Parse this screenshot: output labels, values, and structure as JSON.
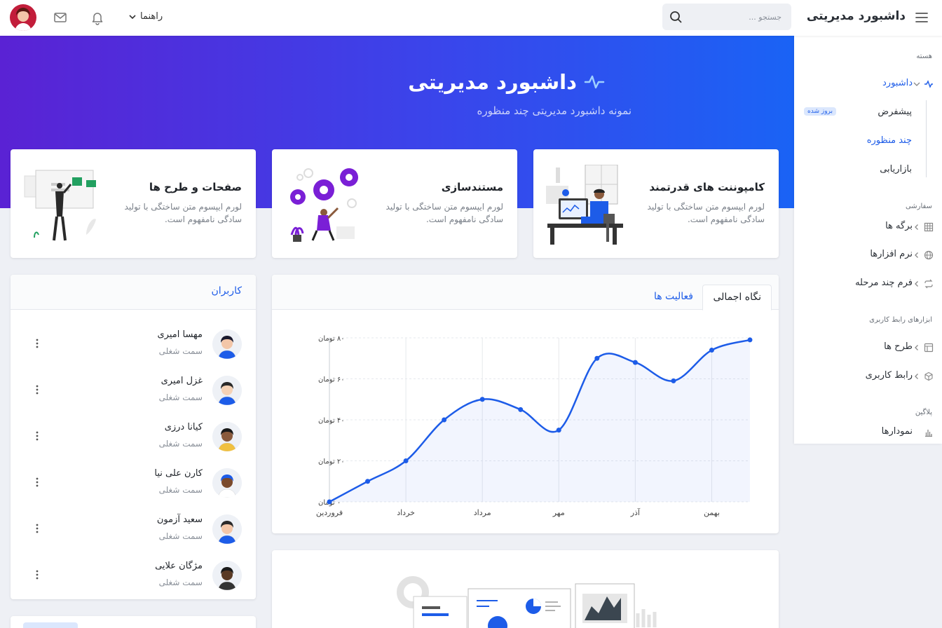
{
  "topbar": {
    "brand": "داشبورد مدیریتی",
    "search_placeholder": "جستجو ...",
    "guide_label": "راهنما"
  },
  "hero": {
    "title": "داشبورد مدیریتی",
    "subtitle": "نمونه داشبورد مدیریتی چند منظوره"
  },
  "sidebar": {
    "heading_core": "هسته",
    "dashboard": "داشبورد",
    "sub_default": "پیشفرض",
    "sub_default_badge": "بروز شده",
    "sub_multi": "چند منظوره",
    "sub_marketing": "بازاریابی",
    "heading_custom": "سفارشی",
    "pages": "برگه ها",
    "apps": "نرم افزارها",
    "multistep": "فرم چند مرحله",
    "heading_ui": "ابزارهای رابط کاربری",
    "layouts": "طرح ها",
    "ui": "رابط کاربری",
    "heading_plugins": "پلاگین",
    "charts": "نمودارها"
  },
  "features": [
    {
      "title": "کامپوننت های قدرتمند",
      "text": "لورم ایپسوم متن ساختگی با تولید سادگی نامفهوم است."
    },
    {
      "title": "مستندسازی",
      "text": "لورم ایپسوم متن ساختگی با تولید سادگی نامفهوم است."
    },
    {
      "title": "صفحات و طرح ها",
      "text": "لورم ایپسوم متن ساختگی با تولید سادگی نامفهوم است."
    }
  ],
  "users": {
    "title": "کاربران",
    "list": [
      {
        "name": "مهسا امیری",
        "role": "سمت شغلی"
      },
      {
        "name": "غزل امیری",
        "role": "سمت شغلی"
      },
      {
        "name": "کیانا درزی",
        "role": "سمت شغلی"
      },
      {
        "name": "کارن علی نیا",
        "role": "سمت شغلی"
      },
      {
        "name": "سعید آزمون",
        "role": "سمت شغلی"
      },
      {
        "name": "مژگان علایی",
        "role": "سمت شغلی"
      }
    ]
  },
  "chart_tabs": {
    "overview": "نگاه اجمالی",
    "activity": "فعالیت ها"
  },
  "colors": {
    "accent": "#1d5ce8",
    "hero_start": "#5a22d4",
    "hero_end": "#1a63f5"
  },
  "chart_data": {
    "type": "area",
    "x": [
      "فروردین",
      "",
      "خرداد",
      "",
      "مرداد",
      "",
      "مهر",
      "",
      "آذر",
      "",
      "بهمن",
      ""
    ],
    "tick_labels_x": [
      "فروردین",
      "خرداد",
      "مرداد",
      "مهر",
      "آذر",
      "بهمن"
    ],
    "tick_labels_y": [
      "۰ تومان",
      "۲۰ تومان",
      "۴۰ تومان",
      "۶۰ تومان",
      "۸۰ تومان"
    ],
    "series": [
      {
        "values": [
          0,
          10,
          20,
          40,
          50,
          45,
          35,
          70,
          68,
          59,
          74,
          79
        ]
      }
    ],
    "ylim": [
      0,
      80
    ],
    "grid": true
  }
}
